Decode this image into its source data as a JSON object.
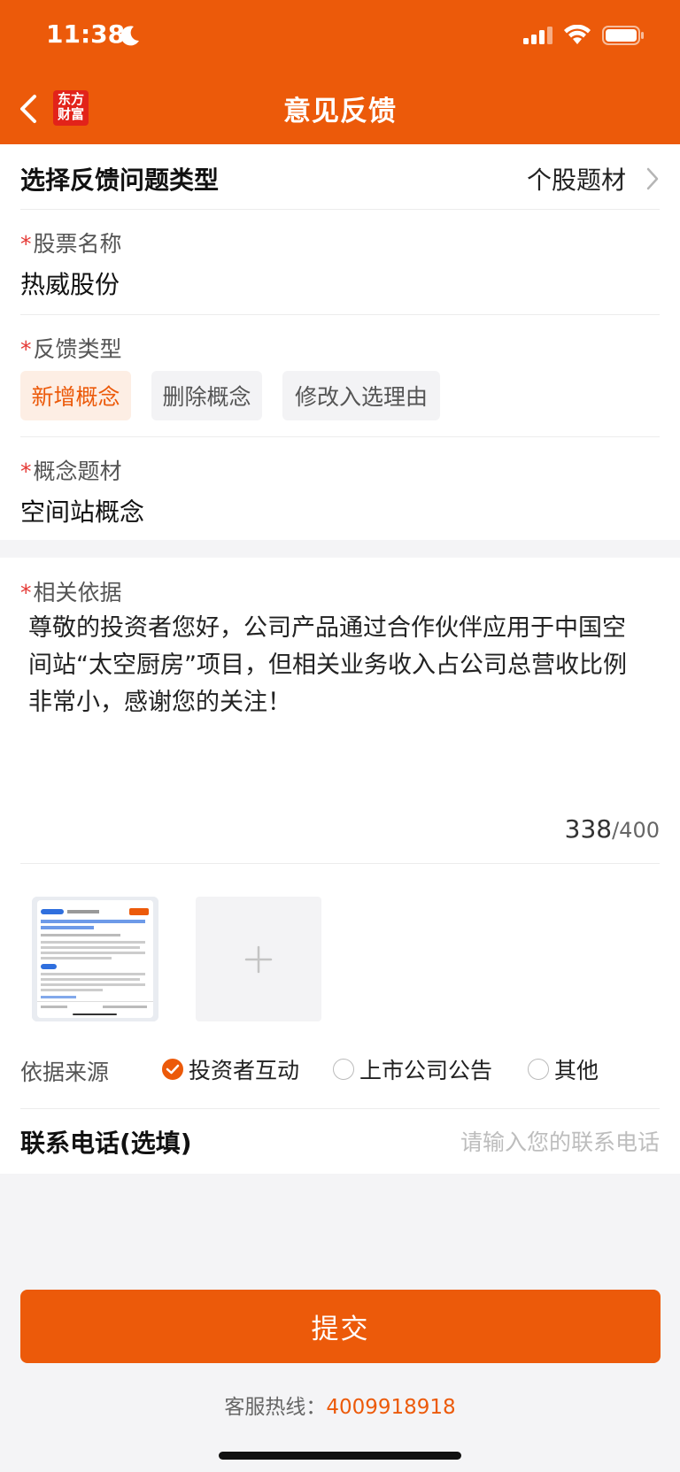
{
  "status_bar": {
    "time": "11:38"
  },
  "header": {
    "back_icon": "chevron-left-icon",
    "logo_line1": "东方",
    "logo_line2": "财富",
    "title": "意见反馈",
    "color": "#ec5a0a"
  },
  "feedback_type": {
    "label": "选择反馈问题类型",
    "value": "个股题材"
  },
  "stock_name": {
    "required": "*",
    "label": "股票名称",
    "value": "热威股份"
  },
  "feedback_kind": {
    "required": "*",
    "label": "反馈类型",
    "options": [
      "新增概念",
      "删除概念",
      "修改入选理由"
    ],
    "selected": "新增概念"
  },
  "concept": {
    "required": "*",
    "label": "概念题材",
    "value": "空间站概念"
  },
  "basis": {
    "required": "*",
    "label": "相关依据",
    "text": "尊敬的投资者您好，公司产品通过合作伙伴应用于中国空间站“太空厨房”项目，但相关业务收入占公司总营收比例非常小，感谢您的关注！",
    "count": "338",
    "max": "/400"
  },
  "attachments": {
    "add_icon": "plus-icon"
  },
  "source": {
    "label": "依据来源",
    "options": [
      "投资者互动",
      "上市公司公告",
      "其他"
    ],
    "selected": "投资者互动"
  },
  "phone": {
    "label": "联系电话(选填)",
    "placeholder": "请输入您的联系电话"
  },
  "submit_label": "提交",
  "hotline": {
    "label": "客服热线：",
    "number": "4009918918"
  }
}
